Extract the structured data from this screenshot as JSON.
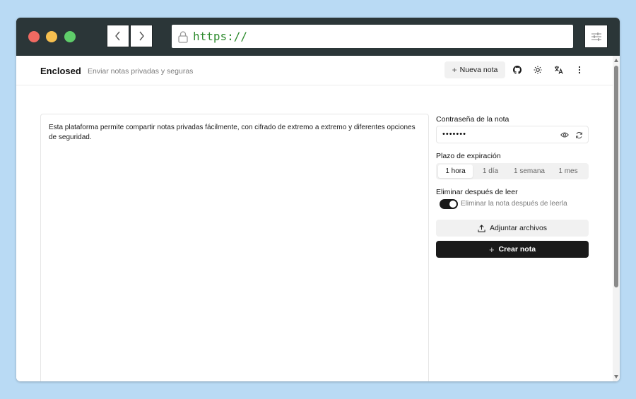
{
  "browser": {
    "url": "https://",
    "traffic_lights": [
      "close",
      "minimize",
      "maximize"
    ]
  },
  "header": {
    "brand": "Enclosed",
    "tagline": "Enviar notas privadas y seguras",
    "new_note_label": "Nueva nota",
    "icons": [
      "github-icon",
      "theme-toggle-icon",
      "translate-icon",
      "more-options-icon"
    ]
  },
  "editor": {
    "content": "Esta plataforma permite compartir notas privadas fácilmente, con cifrado de extremo a extremo y diferentes opciones de seguridad."
  },
  "sidebar": {
    "password_label": "Contraseña de la nota",
    "password_value": "•••••••",
    "expiration_label": "Plazo de expiración",
    "expiration_options": [
      "1 hora",
      "1 día",
      "1 semana",
      "1 mes"
    ],
    "expiration_selected": "1 hora",
    "delete_label": "Eliminar después de leer",
    "delete_toggle_label": "Eliminar la nota después de leerla",
    "delete_toggle_on": true,
    "attach_label": "Adjuntar archivos",
    "create_label": "Crear nota"
  },
  "colors": {
    "background": "#b9daf4",
    "chrome": "#2b3638",
    "url_text": "#2e8b2e",
    "primary_button": "#1a1a1a"
  }
}
